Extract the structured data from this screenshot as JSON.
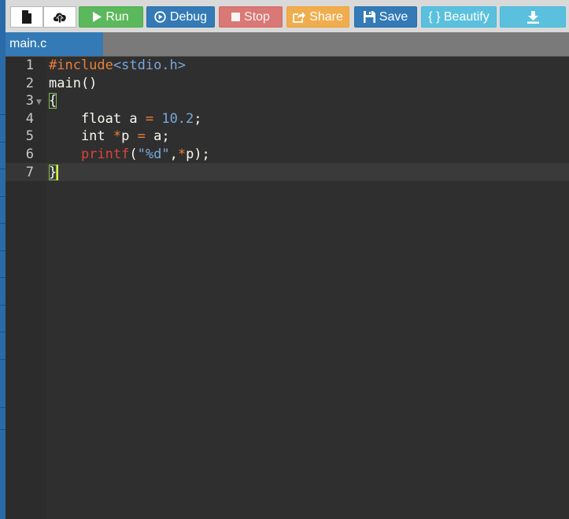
{
  "toolbar": {
    "run_label": "Run",
    "debug_label": "Debug",
    "stop_label": "Stop",
    "share_label": "Share",
    "save_label": "Save",
    "beautify_label": "{ } Beautify"
  },
  "tabs": [
    {
      "label": "main.c",
      "active": true
    }
  ],
  "editor": {
    "line_numbers": [
      "1",
      "2",
      "3",
      "4",
      "5",
      "6",
      "7"
    ],
    "active_line": 7,
    "lines": [
      [
        {
          "t": "#include",
          "c": "pre"
        },
        {
          "t": "<stdio.h>",
          "c": "inc"
        }
      ],
      [
        {
          "t": "main()",
          "c": "id"
        }
      ],
      [
        {
          "t": "{",
          "c": "id",
          "box": true
        }
      ],
      [
        {
          "t": "    float a ",
          "c": "id"
        },
        {
          "t": "=",
          "c": "op"
        },
        {
          "t": " ",
          "c": "id"
        },
        {
          "t": "10.2",
          "c": "num"
        },
        {
          "t": ";",
          "c": "id"
        }
      ],
      [
        {
          "t": "    int ",
          "c": "id"
        },
        {
          "t": "*",
          "c": "op"
        },
        {
          "t": "p ",
          "c": "id"
        },
        {
          "t": "=",
          "c": "op"
        },
        {
          "t": " a;",
          "c": "id"
        }
      ],
      [
        {
          "t": "    ",
          "c": "id"
        },
        {
          "t": "printf",
          "c": "fn"
        },
        {
          "t": "(",
          "c": "id"
        },
        {
          "t": "\"%d\"",
          "c": "str"
        },
        {
          "t": ",",
          "c": "id"
        },
        {
          "t": "*",
          "c": "op"
        },
        {
          "t": "p);",
          "c": "id"
        }
      ],
      [
        {
          "t": "}",
          "c": "id",
          "box": true
        }
      ]
    ]
  },
  "colors": {
    "run": "#5cb85c",
    "debug": "#337ab7",
    "stop": "#d9534f",
    "share": "#f0ad4e",
    "save": "#337ab7",
    "beautify": "#5bc0de",
    "download": "#5bc0de",
    "editor_bg": "#2f2f2f",
    "tab_active": "#337ab7"
  },
  "icons": {
    "new": "new-file-icon",
    "upload": "upload-icon",
    "run": "play-icon",
    "debug": "debug-circle-icon",
    "stop": "stop-square-icon",
    "share": "share-icon",
    "save": "floppy-disk-icon",
    "download": "download-icon"
  }
}
